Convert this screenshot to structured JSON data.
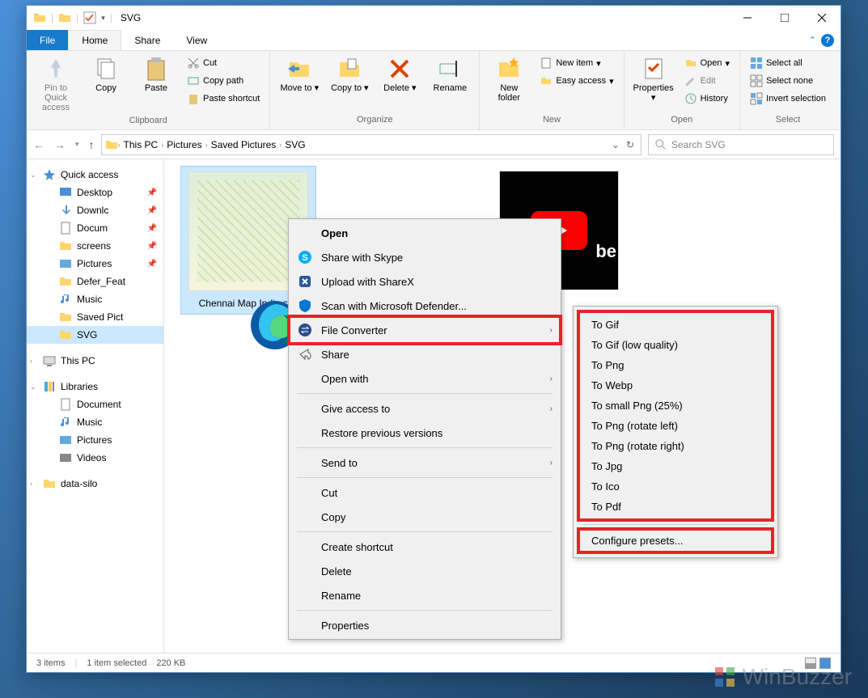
{
  "title": "SVG",
  "tabs": {
    "file": "File",
    "home": "Home",
    "share": "Share",
    "view": "View"
  },
  "ribbon": {
    "clipboard": {
      "label": "Clipboard",
      "pin": "Pin to Quick access",
      "copy": "Copy",
      "paste": "Paste",
      "cut": "Cut",
      "copyPath": "Copy path",
      "pasteShortcut": "Paste shortcut"
    },
    "organize": {
      "label": "Organize",
      "moveTo": "Move to",
      "copyTo": "Copy to",
      "delete": "Delete",
      "rename": "Rename"
    },
    "new": {
      "label": "New",
      "newFolder": "New folder",
      "newItem": "New item",
      "easyAccess": "Easy access"
    },
    "open": {
      "label": "Open",
      "properties": "Properties",
      "open": "Open",
      "edit": "Edit",
      "history": "History"
    },
    "select": {
      "label": "Select",
      "selectAll": "Select all",
      "selectNone": "Select none",
      "invert": "Invert selection"
    }
  },
  "breadcrumb": [
    "This PC",
    "Pictures",
    "Saved Pictures",
    "SVG"
  ],
  "search": {
    "placeholder": "Search SVG"
  },
  "sidebar": {
    "quickAccess": "Quick access",
    "items": [
      "Desktop",
      "Downlc",
      "Docum",
      "screens",
      "Pictures",
      "Defer_Feat",
      "Music",
      "Saved Pict",
      "SVG"
    ],
    "thisPC": "This PC",
    "libraries": "Libraries",
    "libs": [
      "Document",
      "Music",
      "Pictures",
      "Videos"
    ],
    "dataSilo": "data-silo"
  },
  "files": [
    {
      "name": "Chennai Map India.svg"
    }
  ],
  "contextMenu": {
    "open": "Open",
    "shareSkype": "Share with Skype",
    "uploadShareX": "Upload with ShareX",
    "scanDefender": "Scan with Microsoft Defender...",
    "fileConverter": "File Converter",
    "share": "Share",
    "openWith": "Open with",
    "giveAccess": "Give access to",
    "restore": "Restore previous versions",
    "sendTo": "Send to",
    "cut": "Cut",
    "copy": "Copy",
    "createShortcut": "Create shortcut",
    "delete": "Delete",
    "rename": "Rename",
    "properties": "Properties"
  },
  "subMenu": {
    "items": [
      "To Gif",
      "To Gif (low quality)",
      "To Png",
      "To Webp",
      "To small Png (25%)",
      "To Png (rotate left)",
      "To Png (rotate right)",
      "To Jpg",
      "To Ico",
      "To Pdf"
    ],
    "configure": "Configure presets..."
  },
  "status": {
    "items": "3 items",
    "selected": "1 item selected",
    "size": "220 KB"
  },
  "watermark": "WinBuzzer"
}
